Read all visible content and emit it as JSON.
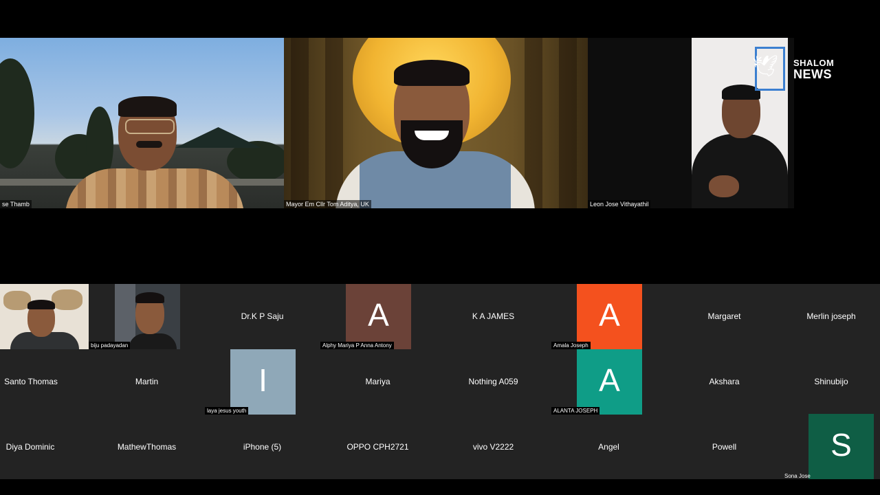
{
  "speakers": [
    {
      "name": "se Thamb"
    },
    {
      "name": "Mayor Em Cllr Tom Aditya, UK"
    },
    {
      "name": "Leon Jose Vithayathil"
    }
  ],
  "logo": {
    "line1": "SHALOM",
    "line2": "NEWS"
  },
  "participants": {
    "row1": [
      {
        "name": "biju padayadan",
        "type": "camera"
      },
      {
        "name": "Dr.K P Saju",
        "type": "name"
      },
      {
        "name": "Alphy Mariya P Anna Antony",
        "type": "avatar",
        "letter": "A",
        "color": "#6b4238"
      },
      {
        "name": "K A JAMES",
        "type": "name"
      },
      {
        "name": "Amala Joseph",
        "type": "avatar",
        "letter": "A",
        "color": "#f4511e"
      },
      {
        "name": "Margaret",
        "type": "name"
      },
      {
        "name": "Merlin joseph",
        "type": "name"
      }
    ],
    "row2": [
      {
        "name": "Santo Thomas",
        "type": "name"
      },
      {
        "name": "Martin",
        "type": "name"
      },
      {
        "name": "laya jesus youth",
        "type": "avatar",
        "letter": "I",
        "color": "#8fa8b8"
      },
      {
        "name": "Mariya",
        "type": "name"
      },
      {
        "name": "Nothing A059",
        "type": "name"
      },
      {
        "name": "ALANTA JOSEPH",
        "type": "avatar",
        "letter": "A",
        "color": "#0f9d87"
      },
      {
        "name": "Akshara",
        "type": "name"
      },
      {
        "name": "Shinubijo",
        "type": "name"
      }
    ],
    "row3": [
      {
        "name": "Diya Dominic",
        "type": "name"
      },
      {
        "name": "MathewThomas",
        "type": "name"
      },
      {
        "name": "iPhone (5)",
        "type": "name"
      },
      {
        "name": "OPPO CPH2721",
        "type": "name"
      },
      {
        "name": "vivo V2222",
        "type": "name"
      },
      {
        "name": "Angel",
        "type": "name"
      },
      {
        "name": "Powell",
        "type": "name"
      },
      {
        "name": "Sona Jose",
        "type": "avatar",
        "letter": "S",
        "color": "#0f5e45"
      }
    ]
  }
}
